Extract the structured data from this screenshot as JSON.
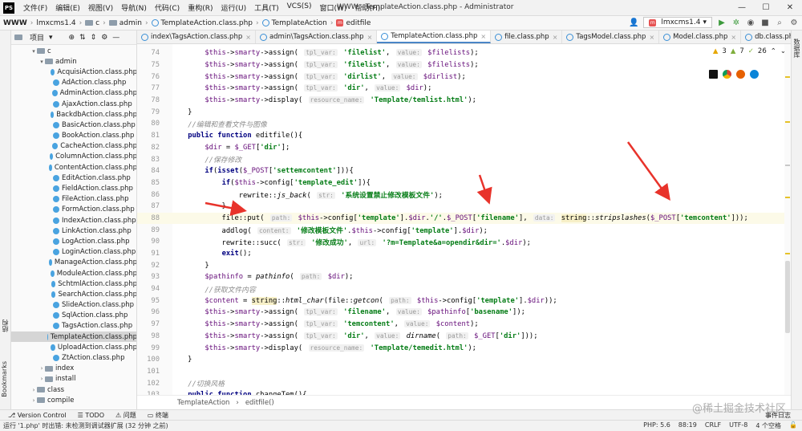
{
  "titlebar": {
    "menu": [
      "文件(F)",
      "编辑(E)",
      "视图(V)",
      "导航(N)",
      "代码(C)",
      "重构(R)",
      "运行(U)",
      "工具(T)",
      "VCS(S)",
      "窗口(W)",
      "帮助(H)"
    ],
    "title": "WWW - TemplateAction.class.php - Administrator"
  },
  "navbar": {
    "crumbs": [
      "WWW",
      "lmxcms1.4",
      "c",
      "admin",
      "TemplateAction.class.php",
      "TemplateAction",
      "editfile"
    ],
    "run_config": "lmxcms1.4"
  },
  "project": {
    "title": "项目",
    "tree": [
      {
        "indent": 2,
        "kind": "folder",
        "open": true,
        "label": "c"
      },
      {
        "indent": 3,
        "kind": "folder",
        "open": true,
        "label": "admin"
      },
      {
        "indent": 4,
        "kind": "file",
        "label": "AcquisiAction.class.php"
      },
      {
        "indent": 4,
        "kind": "file",
        "label": "AdAction.class.php"
      },
      {
        "indent": 4,
        "kind": "file",
        "label": "AdminAction.class.php"
      },
      {
        "indent": 4,
        "kind": "file",
        "label": "AjaxAction.class.php"
      },
      {
        "indent": 4,
        "kind": "file",
        "label": "BackdbAction.class.php"
      },
      {
        "indent": 4,
        "kind": "file",
        "label": "BasicAction.class.php"
      },
      {
        "indent": 4,
        "kind": "file",
        "label": "BookAction.class.php"
      },
      {
        "indent": 4,
        "kind": "file",
        "label": "CacheAction.class.php"
      },
      {
        "indent": 4,
        "kind": "file",
        "label": "ColumnAction.class.php"
      },
      {
        "indent": 4,
        "kind": "file",
        "label": "ContentAction.class.php"
      },
      {
        "indent": 4,
        "kind": "file",
        "label": "EditAction.class.php"
      },
      {
        "indent": 4,
        "kind": "file",
        "label": "FieldAction.class.php"
      },
      {
        "indent": 4,
        "kind": "file",
        "label": "FileAction.class.php"
      },
      {
        "indent": 4,
        "kind": "file",
        "label": "FormAction.class.php"
      },
      {
        "indent": 4,
        "kind": "file",
        "label": "IndexAction.class.php"
      },
      {
        "indent": 4,
        "kind": "file",
        "label": "LinkAction.class.php"
      },
      {
        "indent": 4,
        "kind": "file",
        "label": "LogAction.class.php"
      },
      {
        "indent": 4,
        "kind": "file",
        "label": "LoginAction.class.php"
      },
      {
        "indent": 4,
        "kind": "file",
        "label": "ManageAction.class.php"
      },
      {
        "indent": 4,
        "kind": "file",
        "label": "ModuleAction.class.php"
      },
      {
        "indent": 4,
        "kind": "file",
        "label": "SchtmlAction.class.php"
      },
      {
        "indent": 4,
        "kind": "file",
        "label": "SearchAction.class.php"
      },
      {
        "indent": 4,
        "kind": "file",
        "label": "SlideAction.class.php"
      },
      {
        "indent": 4,
        "kind": "file",
        "label": "SqlAction.class.php"
      },
      {
        "indent": 4,
        "kind": "file",
        "label": "TagsAction.class.php"
      },
      {
        "indent": 4,
        "kind": "file",
        "label": "TemplateAction.class.php",
        "selected": true
      },
      {
        "indent": 4,
        "kind": "file",
        "label": "UploadAction.class.php"
      },
      {
        "indent": 4,
        "kind": "file",
        "label": "ZtAction.class.php"
      },
      {
        "indent": 3,
        "kind": "folder",
        "open": false,
        "label": "index"
      },
      {
        "indent": 3,
        "kind": "folder",
        "open": false,
        "label": "install"
      },
      {
        "indent": 2,
        "kind": "folder",
        "open": false,
        "label": "class"
      },
      {
        "indent": 2,
        "kind": "folder",
        "open": false,
        "label": "compile"
      }
    ]
  },
  "tabs": [
    {
      "label": "index\\TagsAction.class.php",
      "active": false
    },
    {
      "label": "admin\\TagsAction.class.php",
      "active": false
    },
    {
      "label": "TemplateAction.class.php",
      "active": true
    },
    {
      "label": "file.class.php",
      "active": false
    },
    {
      "label": "TagsModel.class.php",
      "active": false
    },
    {
      "label": "Model.class.php",
      "active": false
    },
    {
      "label": "db.class.php",
      "active": false
    }
  ],
  "inspections": {
    "warnings": "3",
    "weak": "7",
    "typos": "26"
  },
  "editor": {
    "lines": [
      {
        "n": "74",
        "html": "        <span class=\"var\">$this</span>-><span class=\"var\">smarty</span>->assign( <span class=\"hint\">tpl_var:</span> <span class=\"str\">'filelist'</span>, <span class=\"hint\">value:</span> <span class=\"var\">$filelists</span>);"
      },
      {
        "n": "75",
        "html": "        <span class=\"var\">$this</span>-><span class=\"var\">smarty</span>->assign( <span class=\"hint\">tpl_var:</span> <span class=\"str\">'filelist'</span>, <span class=\"hint\">value:</span> <span class=\"var\">$filelists</span>);"
      },
      {
        "n": "76",
        "html": "        <span class=\"var\">$this</span>-><span class=\"var\">smarty</span>->assign( <span class=\"hint\">tpl_var:</span> <span class=\"str\">'dirlist'</span>, <span class=\"hint\">value:</span> <span class=\"var\">$dirlist</span>);"
      },
      {
        "n": "77",
        "html": "        <span class=\"var\">$this</span>-><span class=\"var\">smarty</span>->assign( <span class=\"hint\">tpl_var:</span> <span class=\"str\">'dir'</span>, <span class=\"hint\">value:</span> <span class=\"var\">$dir</span>);"
      },
      {
        "n": "78",
        "html": "        <span class=\"var\">$this</span>-><span class=\"var\">smarty</span>->display( <span class=\"hint\">resource_name:</span> <span class=\"str\">'Template/temlist.html'</span>);"
      },
      {
        "n": "79",
        "html": "    }"
      },
      {
        "n": "80",
        "html": "    <span class=\"cmt\">//编辑和查看文件与图像</span>"
      },
      {
        "n": "81",
        "html": "    <span class=\"kw\">public function</span> editfile(){"
      },
      {
        "n": "82",
        "html": "        <span class=\"var\">$dir</span> = <span class=\"var\">$_GET</span>[<span class=\"str\">'dir'</span>];"
      },
      {
        "n": "83",
        "html": "        <span class=\"cmt\">//保存修改</span>"
      },
      {
        "n": "84",
        "html": "        <span class=\"kw\">if</span>(<span class=\"kw\">isset</span>(<span class=\"var\">$_POST</span>[<span class=\"str\">'settemcontent'</span>])){"
      },
      {
        "n": "85",
        "html": "            <span class=\"kw\">if</span>(<span class=\"var\">$this</span>->config[<span class=\"str\">'template_edit'</span>]){"
      },
      {
        "n": "86",
        "html": "                rewrite::<span class=\"fn\">js_back</span>( <span class=\"hint\">str:</span> <span class=\"str\">'系统设置禁止修改模板文件'</span>);"
      },
      {
        "n": "87",
        "html": "            }"
      },
      {
        "n": "88",
        "html": "            file::put( <span class=\"hint\">path:</span> <span class=\"var\">$this</span>->config[<span class=\"str\">'template'</span>].<span class=\"var\">$dir</span>.<span class=\"str\">'/'</span>.<span class=\"var\">$_POST</span>[<span class=\"str\">'filename'</span>], <span class=\"hint\">data:</span> <span class=\"cls\">string</span>::<span class=\"fn\">stripslashes</span>(<span class=\"var\">$_POST</span>[<span class=\"str\">'temcontent'</span>]));",
        "current": true
      },
      {
        "n": "89",
        "html": "            addlog( <span class=\"hint\">content:</span> <span class=\"str\">'修改模板文件'</span>.<span class=\"var\">$this</span>->config[<span class=\"str\">'template'</span>].<span class=\"var\">$dir</span>);"
      },
      {
        "n": "90",
        "html": "            rewrite::succ( <span class=\"hint\">str:</span> <span class=\"str\">'修改成功'</span>, <span class=\"hint\">url:</span> <span class=\"str\">'?m=Template&amp;a=opendir&amp;dir='</span>.<span class=\"var\">$dir</span>);"
      },
      {
        "n": "91",
        "html": "            <span class=\"kw\">exit</span>();"
      },
      {
        "n": "92",
        "html": "        }"
      },
      {
        "n": "93",
        "html": "        <span class=\"var\">$pathinfo</span> = <span class=\"fn\">pathinfo</span>( <span class=\"hint\">path:</span> <span class=\"var\">$dir</span>);"
      },
      {
        "n": "94",
        "html": "        <span class=\"cmt\">//获取文件内容</span>"
      },
      {
        "n": "95",
        "html": "        <span class=\"var\">$content</span> = <span class=\"cls\">string</span>::<span class=\"fn\">html_char</span>(file::<span class=\"fn\">getcon</span>( <span class=\"hint\">path:</span> <span class=\"var\">$this</span>->config[<span class=\"str\">'template'</span>].<span class=\"var\">$dir</span>));"
      },
      {
        "n": "96",
        "html": "        <span class=\"var\">$this</span>-><span class=\"var\">smarty</span>->assign( <span class=\"hint\">tpl_var:</span> <span class=\"str\">'filename'</span>, <span class=\"hint\">value:</span> <span class=\"var\">$pathinfo</span>[<span class=\"str\">'basename'</span>]);"
      },
      {
        "n": "97",
        "html": "        <span class=\"var\">$this</span>-><span class=\"var\">smarty</span>->assign( <span class=\"hint\">tpl_var:</span> <span class=\"str\">'temcontent'</span>, <span class=\"hint\">value:</span> <span class=\"var\">$content</span>);"
      },
      {
        "n": "98",
        "html": "        <span class=\"var\">$this</span>-><span class=\"var\">smarty</span>->assign( <span class=\"hint\">tpl_var:</span> <span class=\"str\">'dir'</span>, <span class=\"hint\">value:</span> <span class=\"fn\">dirname</span>( <span class=\"hint\">path:</span> <span class=\"var\">$_GET</span>[<span class=\"str\">'dir'</span>]));"
      },
      {
        "n": "99",
        "html": "        <span class=\"var\">$this</span>-><span class=\"var\">smarty</span>->display( <span class=\"hint\">resource_name:</span> <span class=\"str\">'Template/temedit.html'</span>);"
      },
      {
        "n": "100",
        "html": "    }"
      },
      {
        "n": "101",
        "html": ""
      },
      {
        "n": "102",
        "html": "    <span class=\"cmt\">//切换风格</span>"
      },
      {
        "n": "103",
        "html": "    <span class=\"kw\">public function</span> changeTem(){"
      }
    ]
  },
  "editor_breadcrumb": [
    "TemplateAction",
    "editfile()"
  ],
  "bottom_tools": [
    "Version Control",
    "TODO",
    "问题",
    "终端"
  ],
  "bottom_right": "事件日志",
  "status": {
    "message": "运行 '1.php' 时出错: 未检测到调试器扩展 (32 分钟 之前)",
    "php": "PHP: 5.6",
    "position": "88:19",
    "line_sep": "CRLF",
    "encoding": "UTF-8",
    "indent": "4 个空格"
  },
  "side_labels": {
    "structure": "结构",
    "bookmarks": "Bookmarks",
    "database": "数据库"
  },
  "watermark": "@稀土掘金技术社区",
  "colors": {
    "arrow": "#e8332b",
    "selection": "#d5d5d5",
    "active_tab": "#4a86c7"
  }
}
